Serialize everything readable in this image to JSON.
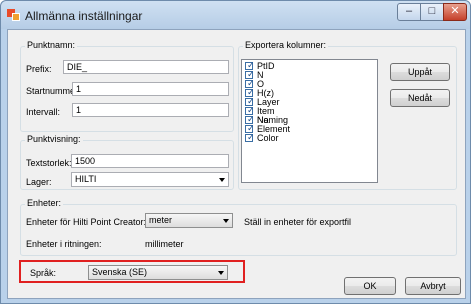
{
  "window": {
    "title": "Allmänna inställningar"
  },
  "punktnamn": {
    "title": "Punktnamn:",
    "prefix_label": "Prefix:",
    "prefix_value": "DIE_",
    "startnummer_label": "Startnumme",
    "startnummer_value": "1",
    "intervall_label": "Intervall:",
    "intervall_value": "1"
  },
  "punktvisning": {
    "title": "Punktvisning:",
    "textstorlek_label": "Textstorlek:",
    "textstorlek_value": "1500",
    "lager_label": "Lager:",
    "lager_value": "HILTI"
  },
  "export": {
    "title": "Exportera kolumner:",
    "columns": [
      {
        "label": "PtID",
        "checked": true
      },
      {
        "label": "N",
        "checked": true
      },
      {
        "label": "O",
        "checked": true
      },
      {
        "label": "H(z)",
        "checked": true
      },
      {
        "label": "Layer",
        "checked": true
      },
      {
        "label": "Item No",
        "checked": true
      },
      {
        "label": "Naming",
        "checked": true
      },
      {
        "label": "Element",
        "checked": true
      },
      {
        "label": "Color",
        "checked": true
      }
    ],
    "up_button": "Uppåt",
    "down_button": "Nedåt"
  },
  "enheter": {
    "title": "Enheter:",
    "hilti_label": "Enheter för Hilti Point Creator:",
    "hilti_value": "meter",
    "export_note": "Ställ in enheter för exportfil",
    "drawing_label": "Enheter i ritningen:",
    "drawing_value": "millimeter"
  },
  "language": {
    "label": "Språk:",
    "value": "Svenska (SE)"
  },
  "footer": {
    "ok_button": "OK",
    "cancel_button": "Avbryt"
  },
  "titlebar_buttons": {
    "minimize": "–",
    "maximize": "□",
    "close": "✕"
  },
  "colors": {
    "highlight": "#e02020",
    "titlebar": "#cfe0f2",
    "close": "#c5402a"
  }
}
